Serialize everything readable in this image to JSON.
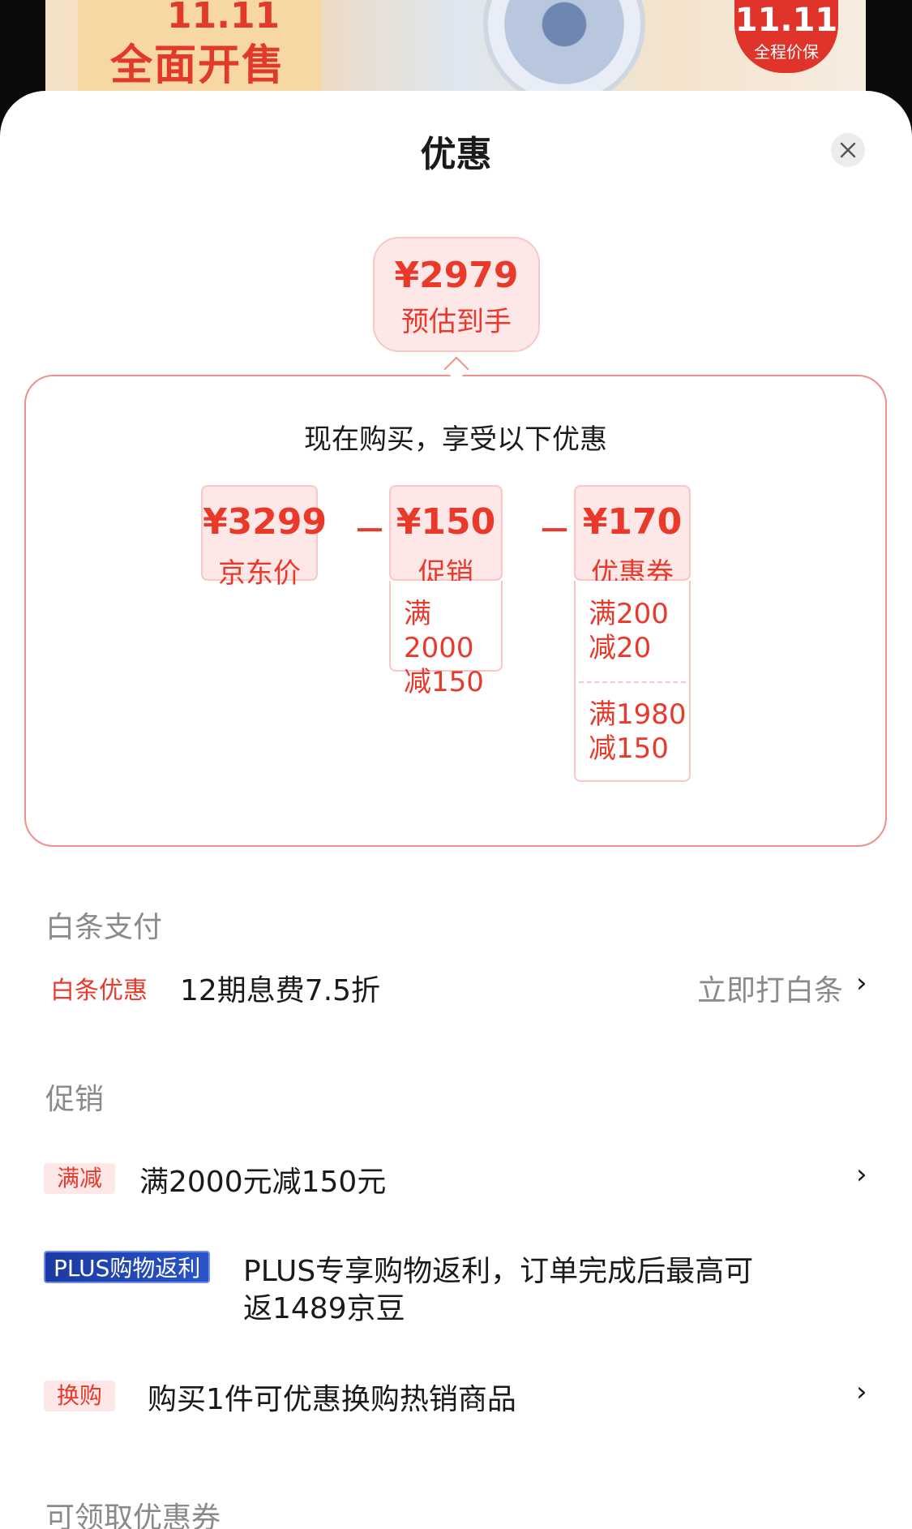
{
  "background": {
    "banner_text": "全面开售",
    "banner_mark": "11.11",
    "badge_mark": "11.11",
    "badge_text": "全程价保"
  },
  "sheet": {
    "title": "优惠",
    "close_icon": "close-icon"
  },
  "estimate": {
    "amount": "¥2979",
    "label": "预估到手"
  },
  "breakdown": {
    "title": "现在购买，享受以下优惠",
    "operator": "－",
    "items": [
      {
        "amount": "¥3299",
        "label": "京东价",
        "rules": []
      },
      {
        "amount": "¥150",
        "label": "促销",
        "rules": [
          [
            "满2000",
            "减150"
          ]
        ]
      },
      {
        "amount": "¥170",
        "label": "优惠券",
        "rules": [
          [
            "满200",
            "减20"
          ],
          [
            "满1980",
            "减150"
          ]
        ]
      }
    ]
  },
  "baitiao": {
    "heading": "白条支付",
    "tag": "白条优惠",
    "text": "12期息费7.5折",
    "link": "立即打白条",
    "chevron": "›"
  },
  "promotion": {
    "heading": "促销",
    "rows": [
      {
        "tag": "满减",
        "text": "满2000元减150元",
        "chevron": "›"
      },
      {
        "tag": "PLUS购物返利",
        "text_line1": "PLUS专享购物返利，订单完成后最高可",
        "text_line2": "返1489京豆"
      },
      {
        "tag": "换购",
        "text": "购买1件可优惠换购热销商品",
        "chevron": "›"
      }
    ]
  },
  "coupons": {
    "heading": "可领取优惠券"
  }
}
